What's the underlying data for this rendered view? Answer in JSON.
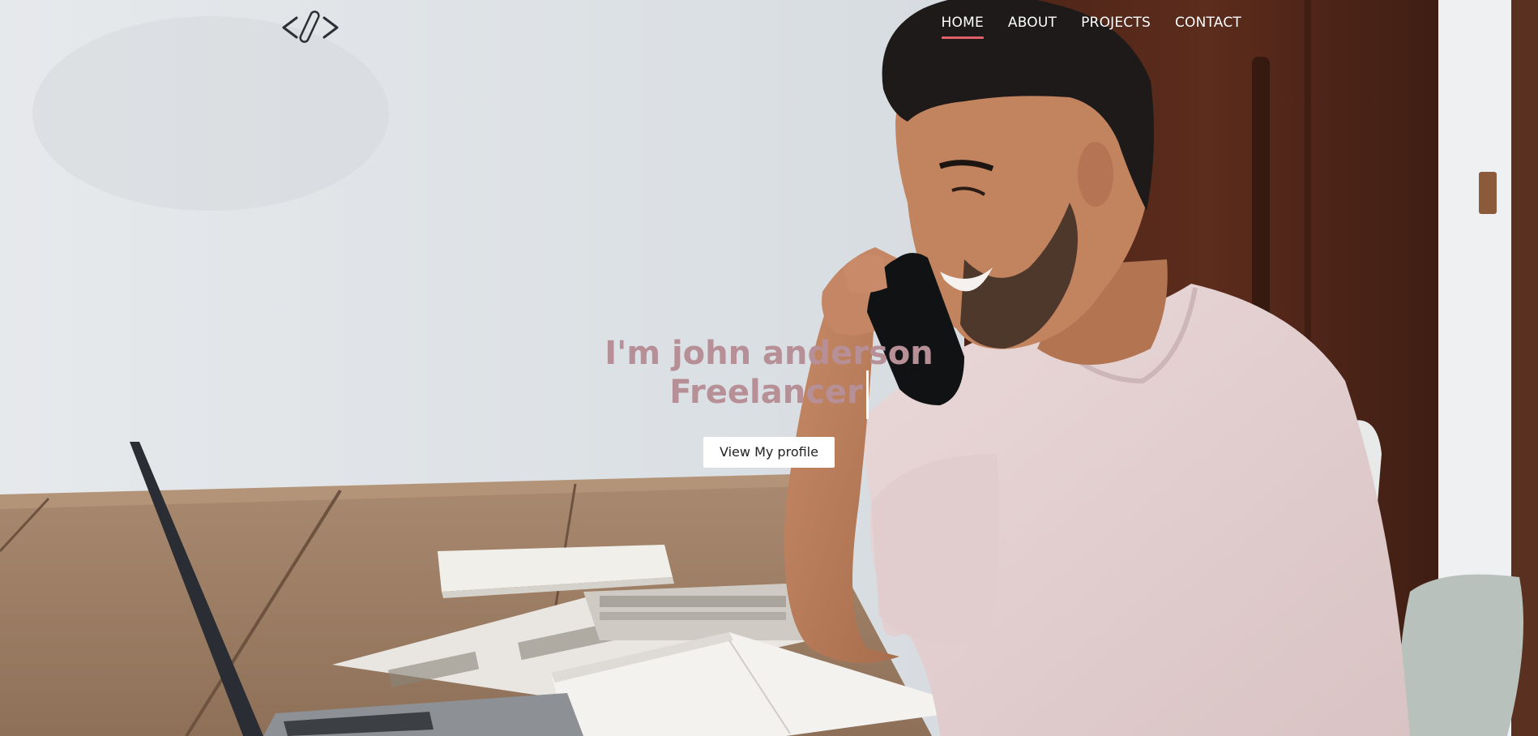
{
  "brand": {
    "logo_icon": "code-brackets-icon"
  },
  "nav": {
    "items": [
      {
        "label": "HOME",
        "active": true
      },
      {
        "label": "ABOUT",
        "active": false
      },
      {
        "label": "PROJECTS",
        "active": false
      },
      {
        "label": "CONTACT",
        "active": false
      }
    ],
    "active_underline_color": "#e0606a"
  },
  "hero": {
    "title": "I'm john anderson",
    "subtitle": "Freelancer",
    "cta_label": "View My profile",
    "text_color": "#b69096"
  }
}
